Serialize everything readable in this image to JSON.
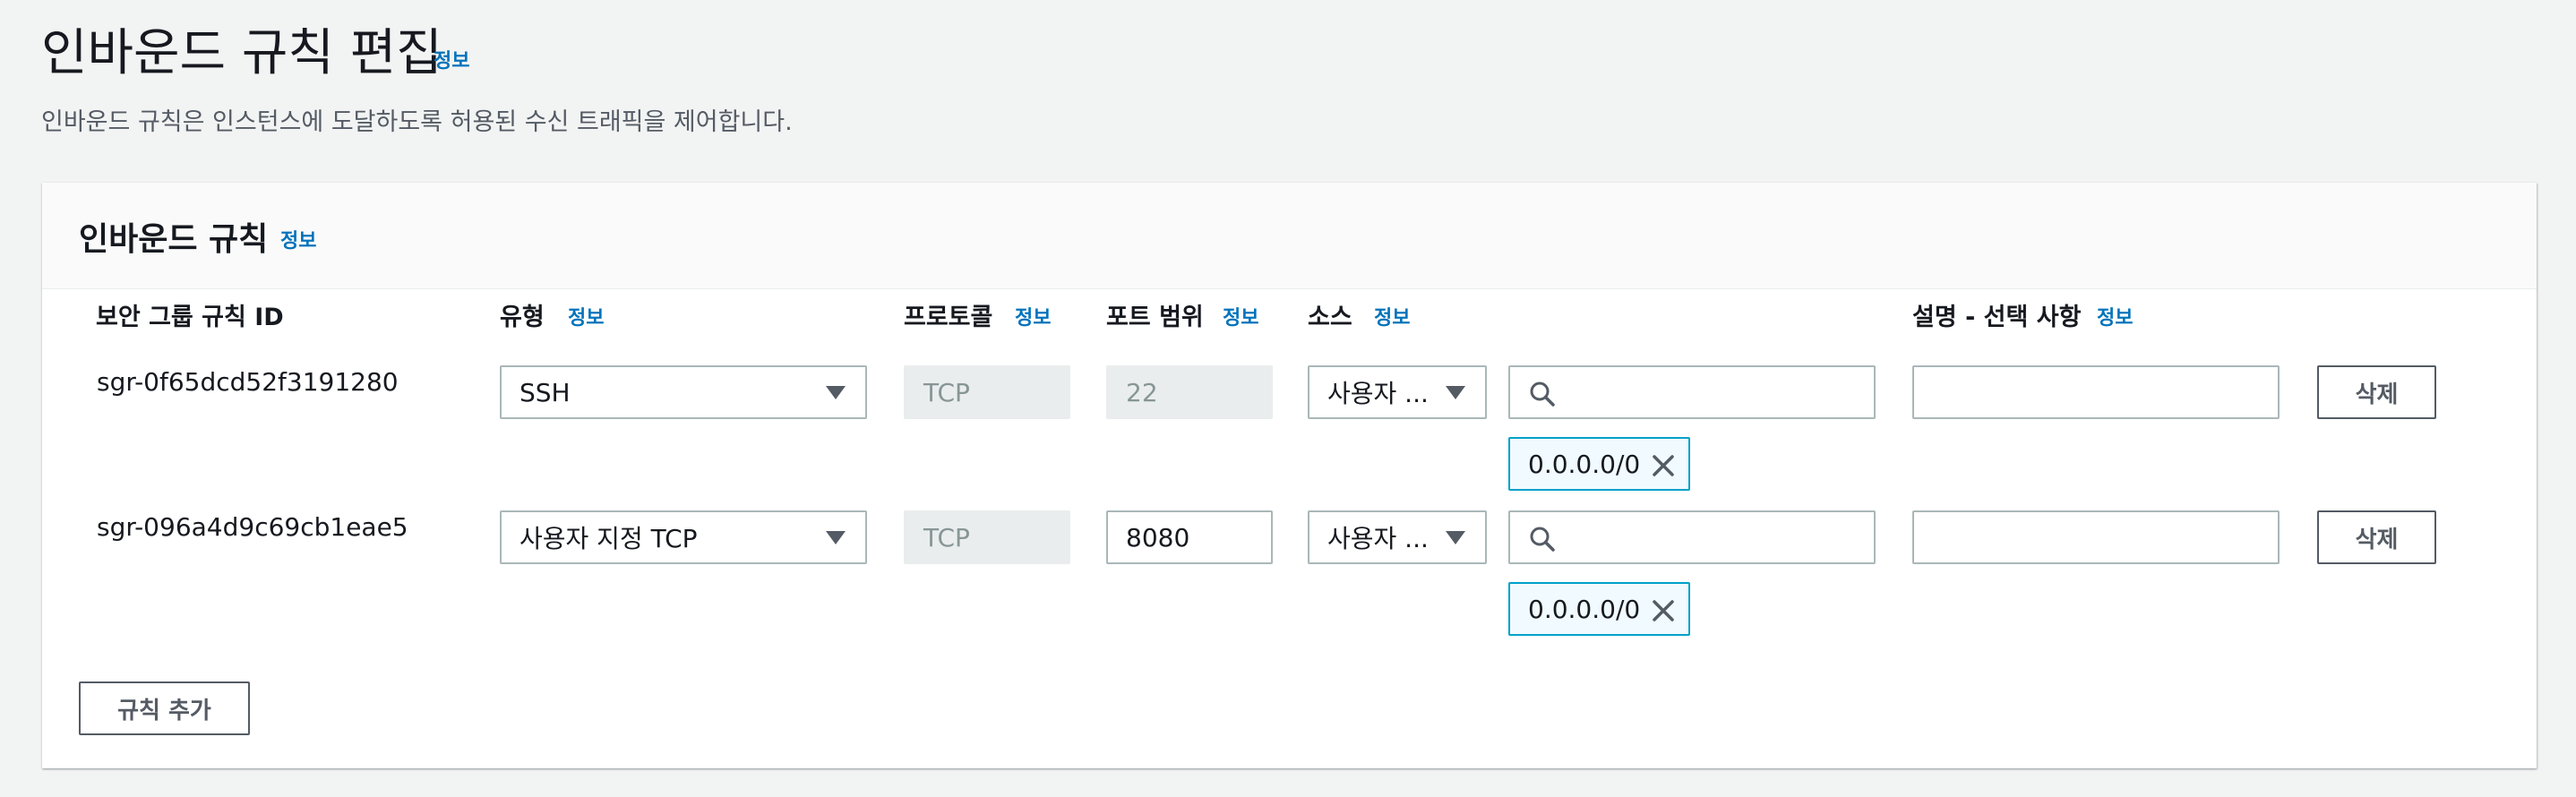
{
  "page": {
    "title": "인바운드 규칙 편집",
    "title_info": "정보",
    "description": "인바운드 규칙은 인스턴스에 도달하도록 허용된 수신 트래픽을 제어합니다."
  },
  "panel": {
    "title": "인바운드 규칙",
    "title_info": "정보",
    "columns": {
      "rule_id": "보안 그룹 규칙 ID",
      "type": "유형",
      "protocol": "프로토콜",
      "port_range": "포트 범위",
      "source": "소스",
      "description": "설명 - 선택 사항",
      "info": "정보"
    },
    "rows": [
      {
        "rule_id": "sgr-0f65dcd52f3191280",
        "type": "SSH",
        "protocol": "TCP",
        "port_range": "22",
        "source_type": "사용자 ...",
        "source_search": "",
        "source_token": "0.0.0.0/0",
        "description": "",
        "delete_label": "삭제"
      },
      {
        "rule_id": "sgr-096a4d9c69cb1eae5",
        "type": "사용자 지정 TCP",
        "protocol": "TCP",
        "port_range": "8080",
        "source_type": "사용자 ...",
        "source_search": "",
        "source_token": "0.0.0.0/0",
        "description": "",
        "delete_label": "삭제"
      }
    ],
    "add_rule_label": "규칙 추가"
  },
  "icons": {
    "dropdown": "caret-down-icon",
    "search": "search-icon",
    "remove": "close-icon"
  },
  "colors": {
    "link": "#0073bb",
    "token_border": "#00a1c9",
    "token_bg": "#f1faff"
  }
}
